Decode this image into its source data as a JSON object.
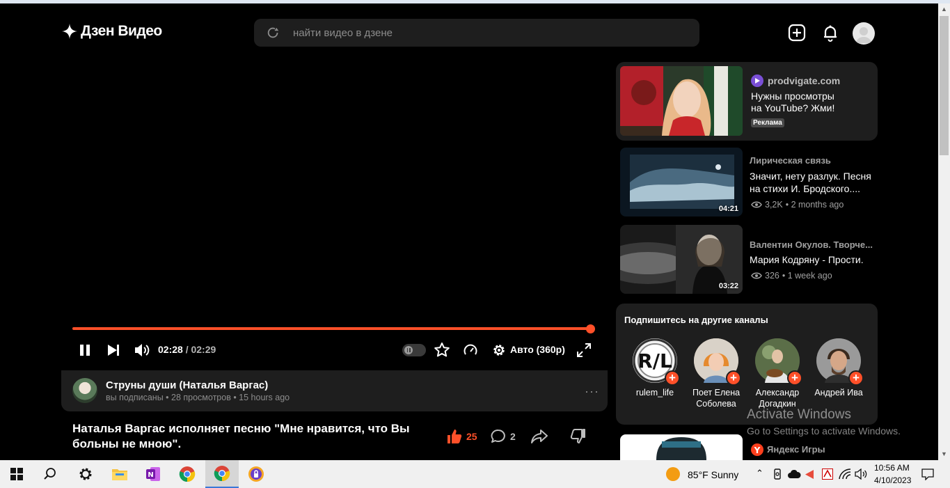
{
  "header": {
    "logo_text": "Дзен Видео",
    "search_placeholder": "найти видео в дзене"
  },
  "player": {
    "current_time": "02:28",
    "separator": "/",
    "duration": "02:29",
    "quality_label": "Авто (360p)",
    "progress": 0.99
  },
  "channel": {
    "name": "Струны души (Наталья Варгас)",
    "meta": "вы подписаны • 28 просмотров • 15 hours ago",
    "more": "···"
  },
  "video": {
    "title": "Наталья Варгас исполняет песню \"Мне нравится, что Вы больны не мною\".",
    "likes": "25",
    "comments": "2"
  },
  "ad": {
    "source": "prodvigate.com",
    "title_line1": "Нужны просмотры",
    "title_line2": "на YouTube? Жми!",
    "badge": "Реклама"
  },
  "recommendations": [
    {
      "channel": "Лирическая связь",
      "title_line1": "Значит, нету разлук. Песня",
      "title_line2": "на стихи И. Бродского....",
      "duration": "04:21",
      "views": "3,2K",
      "age": "• 2 months ago"
    },
    {
      "channel": "Валентин Окулов. Творче...",
      "title_line1": "Мария Кодряну - Прости.",
      "title_line2": "",
      "duration": "03:22",
      "views": "326",
      "age": "• 1 week ago"
    }
  ],
  "subscribe": {
    "title": "Подпишитесь на другие каналы",
    "channels": [
      {
        "name_line1": "rulem_life",
        "name_line2": ""
      },
      {
        "name_line1": "Поет Елена",
        "name_line2": "Соболева"
      },
      {
        "name_line1": "Александр",
        "name_line2": "Догадкин"
      },
      {
        "name_line1": "Андрей Ива",
        "name_line2": ""
      }
    ]
  },
  "next_card": {
    "channel": "Яндекс Игры"
  },
  "watermark": {
    "line1": "Activate Windows",
    "line2": "Go to Settings to activate Windows."
  },
  "taskbar": {
    "weather": "85°F  Sunny",
    "time": "10:56 AM",
    "date": "4/10/2023"
  },
  "colors": {
    "accent": "#ff5029",
    "background": "#000000",
    "card": "#1e1e1e"
  }
}
